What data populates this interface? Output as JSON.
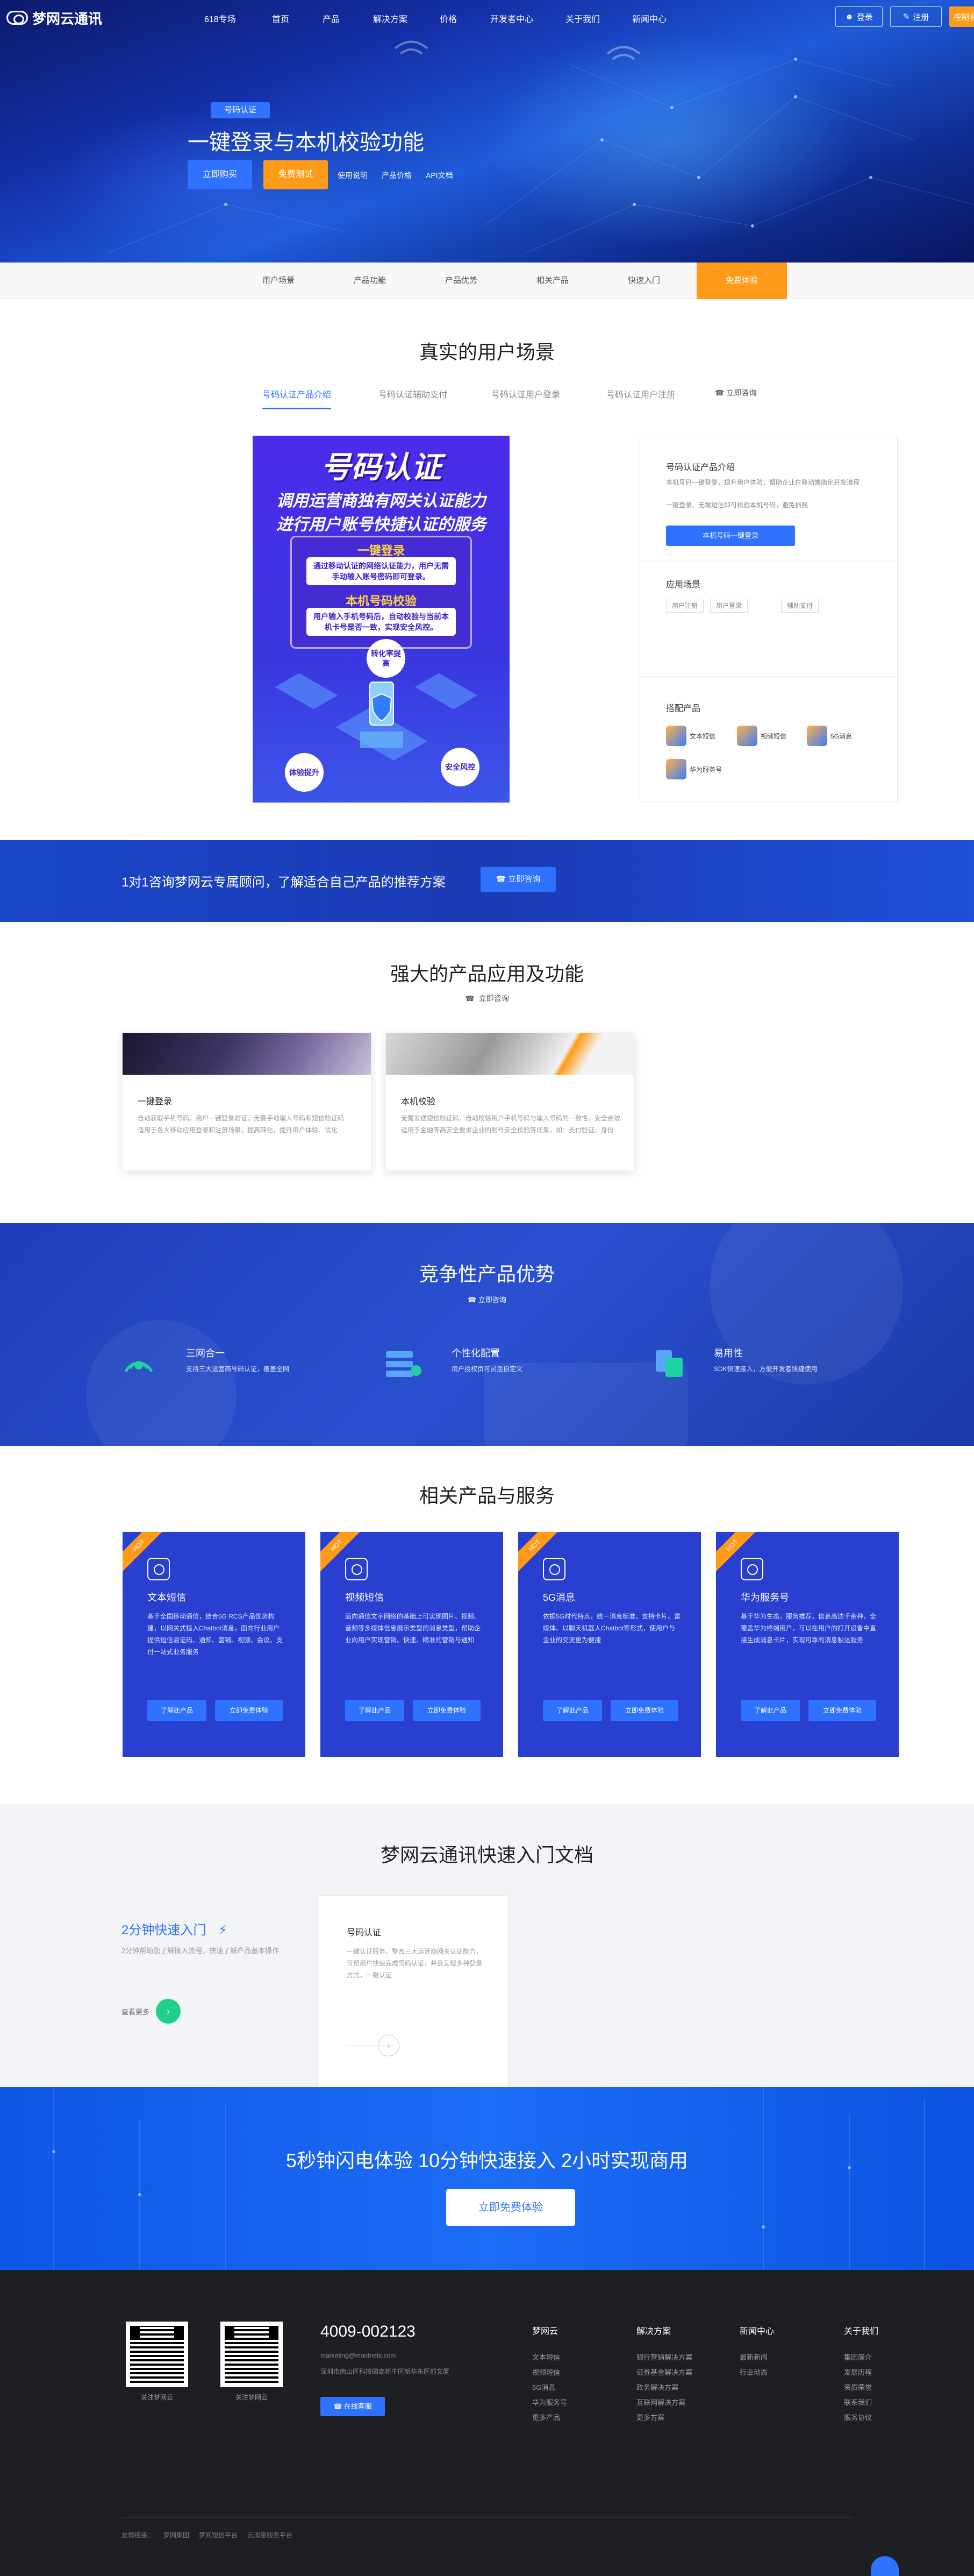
{
  "brand": {
    "name": "梦网云通讯"
  },
  "topnav": {
    "items": [
      "618专场",
      "首页",
      "产品",
      "解决方案",
      "价格",
      "开发者中心",
      "关于我们",
      "新闻中心"
    ],
    "login": "登录",
    "register": "注册",
    "console": "控制台"
  },
  "hero": {
    "tag": "号码认证",
    "title": "一键登录与本机校验功能",
    "btn_primary": "立即购买",
    "btn_secondary": "免费测试",
    "links": [
      "使用说明",
      "产品价格",
      "API文档"
    ]
  },
  "subnav": {
    "items": [
      "用户场景",
      "产品功能",
      "产品优势",
      "相关产品",
      "快速入门",
      "免费体验"
    ]
  },
  "scenes": {
    "title": "真实的用户场景",
    "tabs": [
      "号码认证产品介绍",
      "号码认证辅助支付",
      "号码认证用户登录",
      "号码认证用户注册"
    ],
    "consult": "立即咨询",
    "poster": {
      "title": "号码认证",
      "line1": "调用运营商独有网关认证能力",
      "line2": "进行用户账号快捷认证的服务",
      "h1": "一键登录",
      "t1": "通过移动认证的网络认证能力，用户无需手动输入账号密码即可登录。",
      "h2": "本机号码校验",
      "t2": "用户输入手机号码后，自动校验与当前本机卡号是否一致，实现安全风控。",
      "b1": "转化率提高",
      "b2": "体验提升",
      "b3": "安全风控"
    },
    "card": {
      "intro_title": "号码认证产品介绍",
      "intro_text": "本机号码一键登录，提升用户体验，帮助企业在移动端简化开发流程",
      "intro_text2": "一键登录、无需短信即可校验本机号码，避免损耗",
      "intro_btn": "本机号码一键登录",
      "scene_title": "应用场景",
      "chips": [
        "用户注册",
        "用户登录",
        "辅助支付"
      ],
      "products_title": "搭配产品",
      "products": [
        "文本短信",
        "视频短信",
        "5G消息",
        "华为服务号"
      ]
    }
  },
  "consult_banner": {
    "text": "1对1咨询梦网云专属顾问，了解适合自己产品的推荐方案",
    "btn": "立即咨询"
  },
  "features": {
    "title": "强大的产品应用及功能",
    "consult": "立即咨询",
    "items": [
      {
        "title": "一键登录",
        "line1": "自动获取手机号码，用户一键登录验证，无需手动输入号码和短信验证码",
        "line2": "适用于各大移动应用登录和注册场景，提高转化，提升用户体验、优化"
      },
      {
        "title": "本机校验",
        "line1": "无需发送短信验证码，自动校验用户手机号码与输入号码的一致性，安全高效",
        "line2": "适用于金融等高安全要求企业的账号安全校验等场景，如：支付验证、身份"
      }
    ]
  },
  "advantages": {
    "title": "竞争性产品优势",
    "consult": "立即咨询",
    "items": [
      {
        "title": "三网合一",
        "text": "支持三大运营商号码认证，覆盖全网"
      },
      {
        "title": "个性化配置",
        "text": "用户授权页可灵活自定义"
      },
      {
        "title": "易用性",
        "text": "SDK快速接入，方便开发者快捷使用"
      }
    ]
  },
  "related": {
    "title": "相关产品与服务",
    "badge": "HOT",
    "items": [
      {
        "title": "文本短信",
        "text": "基于全国移动通信，结合5G RCS产品优势构建，以网关式植入Chatbot消息，面向行业用户提供短信验证码、通知、营销、视频、会议、支付一站式业务服务"
      },
      {
        "title": "视频短信",
        "text": "面向通信文字网络的基础上可实现图片、视频、音频等多媒体信息展示类型的消息类型，帮助企业向用户实现营销、快速、精准的营销与通知"
      },
      {
        "title": "5G消息",
        "text": "依据5G时代特点，统一消息标准，支持卡片、富媒体、以聊天机器人Chatbot等形式，使用户与企业的交流更为便捷"
      },
      {
        "title": "华为服务号",
        "text": "基于华为生态，服务推荐，信息高达千余种，全覆盖华为终端用户，可以在用户的打开设备中直接生成消息卡片，实现可靠的消息触达服务"
      }
    ],
    "btn_learn": "了解此产品",
    "btn_try": "立即免费体验"
  },
  "docs": {
    "title": "梦网云通讯快速入门文档",
    "quick_title": "2分钟快速入门",
    "quick_text": "2分钟帮助您了解接入流程，快速了解产品基本操作",
    "more": "查看更多",
    "card_title": "号码认证",
    "card_text": "一键认证服务，整合三大运营商网关认证能力，可帮用户快速完成号码认证，并且实现多种登录方式，一键认证"
  },
  "cta": {
    "text": "5秒钟闪电体验  10分钟快速接入  2小时实现商用",
    "btn": "立即免费体验"
  },
  "footer": {
    "qr1": "关注梦网云",
    "qr2": "关注梦网云",
    "phone": "4009-002123",
    "email": "marketing@montnets.com",
    "address": "深圳市南山区科技园高新中区新华东区前文厦",
    "online": "在线客服",
    "cols": [
      {
        "title": "梦网云",
        "items": [
          "文本短信",
          "视频短信",
          "5G消息",
          "华为服务号",
          "更多产品"
        ]
      },
      {
        "title": "解决方案",
        "items": [
          "银行营销解决方案",
          "证券基金解决方案",
          "政务解决方案",
          "互联网解决方案",
          "更多方案"
        ]
      },
      {
        "title": "新闻中心",
        "items": [
          "最新新闻",
          "行业动态"
        ]
      },
      {
        "title": "关于我们",
        "items": [
          "集团简介",
          "发展历程",
          "资质荣誉",
          "联系我们",
          "服务协议"
        ]
      }
    ],
    "bottom": [
      "友情链接：",
      "梦网集团",
      "梦网短信平台",
      "云消息服务平台"
    ]
  }
}
